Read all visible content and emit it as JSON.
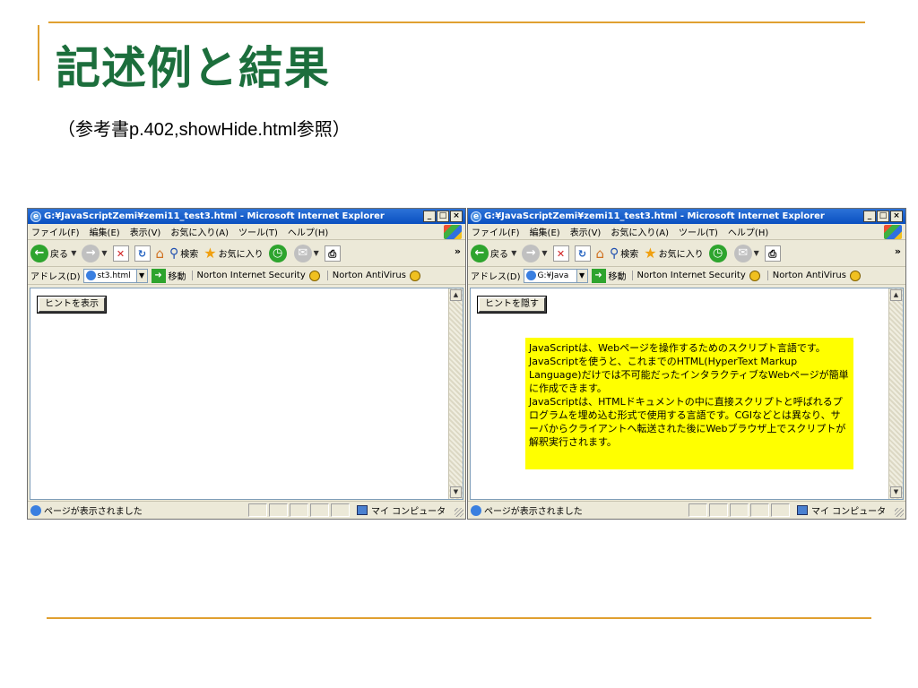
{
  "slide": {
    "title": "記述例と結果",
    "subtitle": "（参考書p.402,showHide.html参照）"
  },
  "browser": {
    "title": "G:¥JavaScriptZemi¥zemi11_test3.html - Microsoft Internet Explorer",
    "menu": [
      "ファイル(F)",
      "編集(E)",
      "表示(V)",
      "お気に入り(A)",
      "ツール(T)",
      "ヘルプ(H)"
    ],
    "toolbar": {
      "back_label": "戻る",
      "search_label": "検索",
      "favorites_label": "お気に入り"
    },
    "address": {
      "label": "アドレス(D)",
      "go_label": "移動",
      "norton_security": "Norton Internet Security",
      "norton_antivirus": "Norton AntiVirus"
    },
    "status": {
      "text": "ページが表示されました",
      "zone": "マイ コンピュータ"
    }
  },
  "left_window": {
    "address_value": "st3.html",
    "button_label": "ヒントを表示"
  },
  "right_window": {
    "address_value": "G:¥Java",
    "button_label": "ヒントを隠す",
    "hint_text": "JavaScriptは、Webページを操作するためのスクリプト言語です。JavaScriptを使うと、これまでのHTML(HyperText Markup Language)だけでは不可能だったインタラクティブなWebページが簡単に作成できます。\nJavaScriptは、HTMLドキュメントの中に直接スクリプトと呼ばれるプログラムを埋め込む形式で使用する言語です。CGIなどとは異なり、サーバからクライアントへ転送された後にWebブラウザ上でスクリプトが解釈実行されます。"
  },
  "colors": {
    "title_green": "#1c6e3c",
    "rule_orange": "#e0a030",
    "hint_bg": "#ffff00",
    "titlebar_blue": "#0a50c0"
  }
}
